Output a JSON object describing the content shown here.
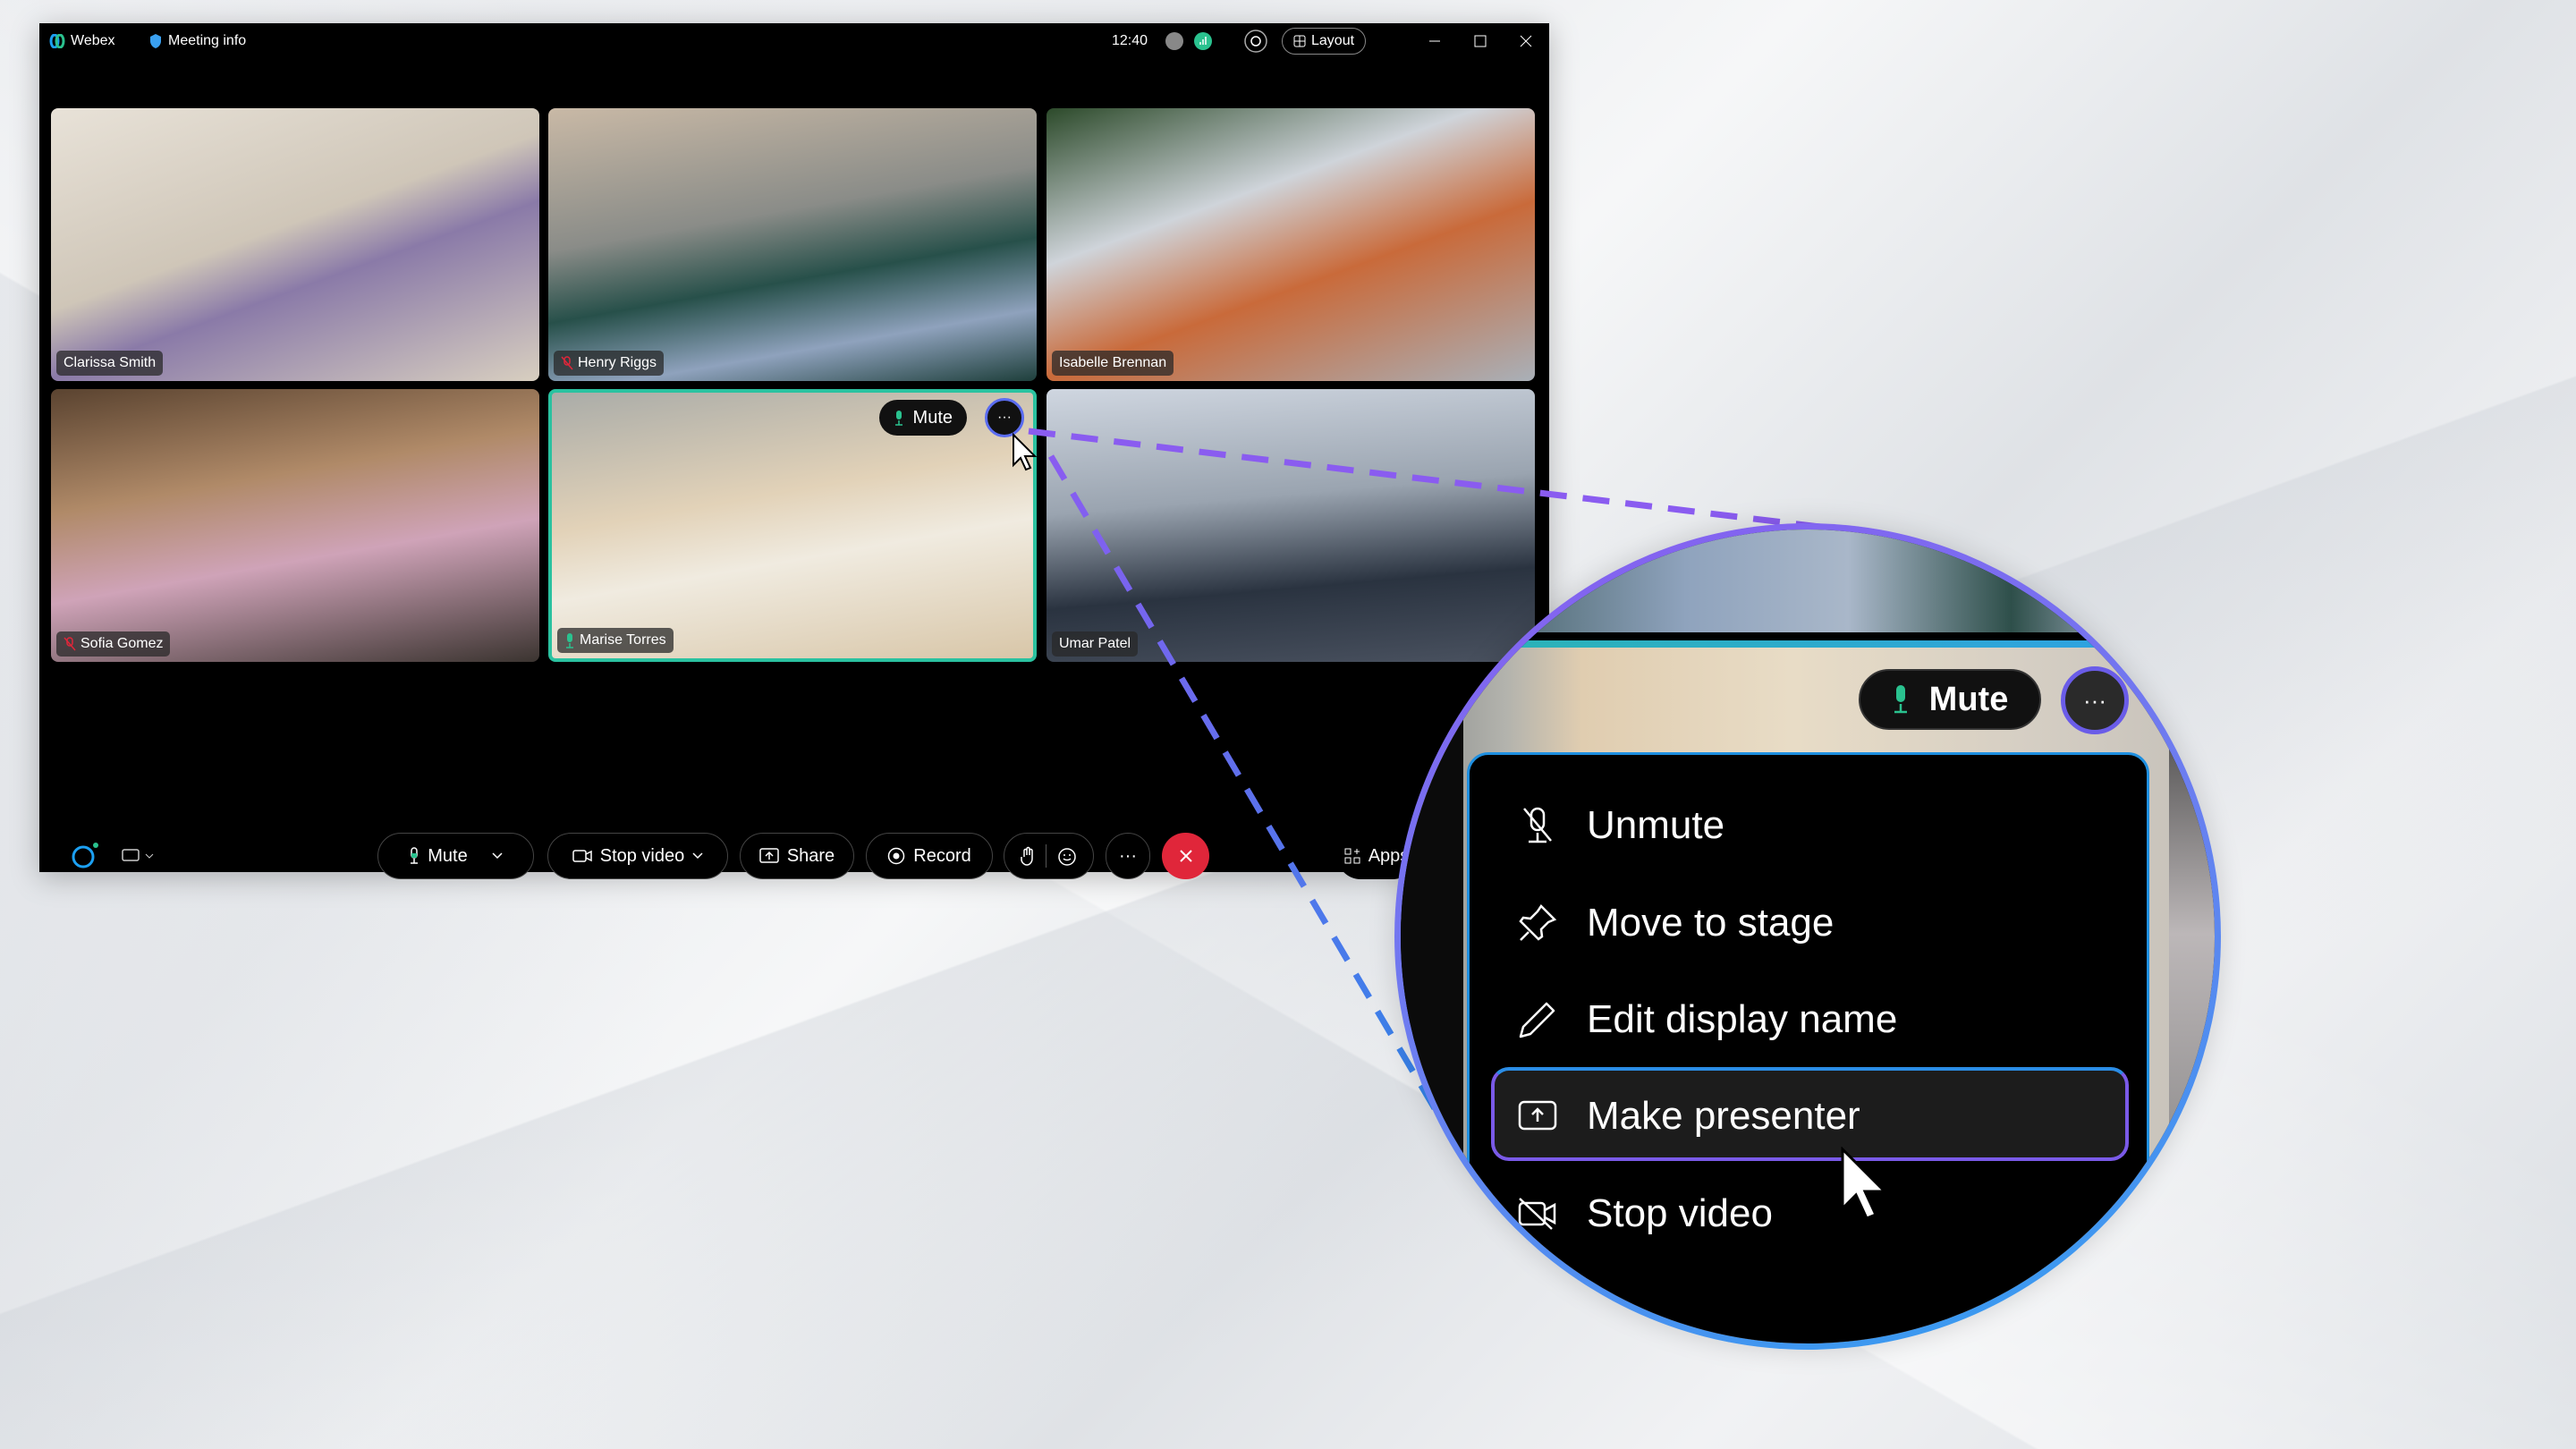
{
  "titlebar": {
    "app_name": "Webex",
    "meeting_info": "Meeting info",
    "time": "12:40",
    "layout_label": "Layout"
  },
  "participants": [
    {
      "name": "Clarissa Smith",
      "mic": "none"
    },
    {
      "name": "Henry Riggs",
      "mic": "muted"
    },
    {
      "name": "Isabelle Brennan",
      "mic": "none"
    },
    {
      "name": "Sofia Gomez",
      "mic": "muted"
    },
    {
      "name": "Marise Torres",
      "mic": "active",
      "selected": true
    },
    {
      "name": "Umar Patel",
      "mic": "none"
    }
  ],
  "tile_overlay": {
    "mute_label": "Mute",
    "more_label": "···"
  },
  "toolbar": {
    "mute": "Mute",
    "stop_video": "Stop video",
    "share": "Share",
    "record": "Record",
    "more": "···",
    "apps": "Apps"
  },
  "context_menu": {
    "items": [
      {
        "label": "Unmute",
        "icon": "mic-off-icon"
      },
      {
        "label": "Move to stage",
        "icon": "pin-icon"
      },
      {
        "label": "Edit display name",
        "icon": "pencil-icon"
      },
      {
        "label": "Make presenter",
        "icon": "share-screen-icon",
        "highlighted": true
      },
      {
        "label": "Stop video",
        "icon": "video-off-icon"
      }
    ]
  },
  "colors": {
    "accent_green": "#2ac28f",
    "end_call": "#e0263a",
    "highlight_purple": "#7a5ae8",
    "highlight_blue": "#2b8de6"
  }
}
